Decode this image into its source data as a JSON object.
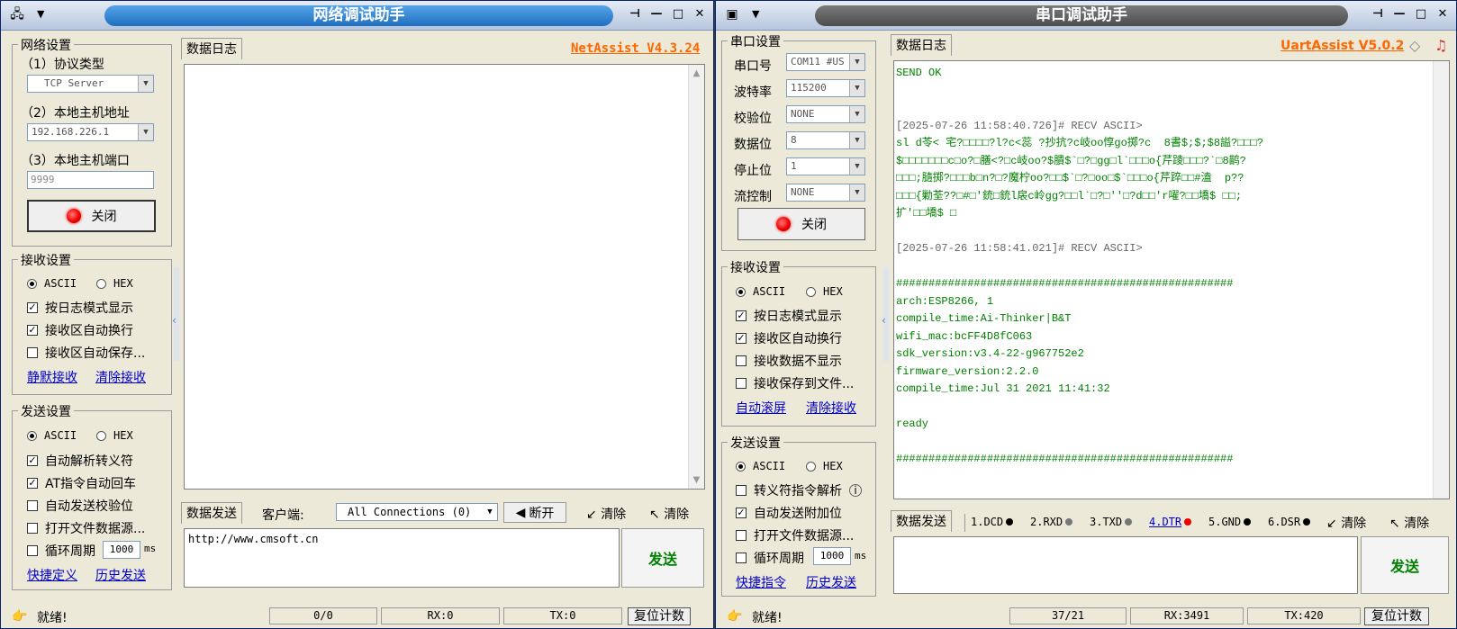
{
  "net": {
    "title": "网络调试助手",
    "brand": "NetAssist V4.3.24",
    "net_settings": {
      "group": "网络设置",
      "protocol_label": "（1）协议类型",
      "protocol_value": "TCP Server",
      "host_label": "（2）本地主机地址",
      "host_value": "192.168.226.1",
      "port_label": "（3）本地主机端口",
      "port_value": "9999",
      "close_button": "关闭"
    },
    "recv_settings": {
      "group": "接收设置",
      "ascii": "ASCII",
      "hex": "HEX",
      "opt1": "按日志模式显示",
      "opt2": "接收区自动换行",
      "opt3": "接收区自动保存...",
      "link1": "静默接收",
      "link2": "清除接收"
    },
    "send_settings": {
      "group": "发送设置",
      "ascii": "ASCII",
      "hex": "HEX",
      "opt1": "自动解析转义符",
      "opt2": "AT指令自动回车",
      "opt3": "自动发送校验位",
      "opt4": "打开文件数据源...",
      "opt5": "循环周期",
      "period": "1000",
      "unit": "ms",
      "link1": "快捷定义",
      "link2": "历史发送"
    },
    "log_tab": "数据日志",
    "send_tab": "数据发送",
    "client_label": "客户端:",
    "client_value": "All Connections (0)",
    "disconnect": "断开",
    "clear1": "清除",
    "clear2": "清除",
    "send_text": "http://www.cmsoft.cn",
    "send_button": "发送",
    "status": {
      "ready": "就绪!",
      "count": "0/0",
      "rx": "RX:0",
      "tx": "TX:0",
      "reset": "复位计数"
    }
  },
  "uart": {
    "title": "串口调试助手",
    "brand": "UartAssist V5.0.2",
    "port_settings": {
      "group": "串口设置",
      "port_label": "串口号",
      "port_value": "COM11 #US",
      "baud_label": "波特率",
      "baud_value": "115200",
      "parity_label": "校验位",
      "parity_value": "NONE",
      "data_label": "数据位",
      "data_value": "8",
      "stop_label": "停止位",
      "stop_value": "1",
      "flow_label": "流控制",
      "flow_value": "NONE",
      "close_button": "关闭"
    },
    "recv_settings": {
      "group": "接收设置",
      "ascii": "ASCII",
      "hex": "HEX",
      "opt1": "按日志模式显示",
      "opt2": "接收区自动换行",
      "opt3": "接收数据不显示",
      "opt4": "接收保存到文件...",
      "link1": "自动滚屏",
      "link2": "清除接收"
    },
    "send_settings": {
      "group": "发送设置",
      "ascii": "ASCII",
      "hex": "HEX",
      "opt1": "转义符指令解析",
      "opt2": "自动发送附加位",
      "opt3": "打开文件数据源...",
      "opt4": "循环周期",
      "period": "1000",
      "unit": "ms",
      "link1": "快捷指令",
      "link2": "历史发送"
    },
    "log_tab": "数据日志",
    "log_lines": [
      "SEND OK",
      "",
      "",
      "[2025-07-26 11:58:40.726]# RECV ASCII>",
      "sl d苓< 宅?□□□□?l?c<蕊 ?抄抗?c岐oo惇go掷?c  8書$;$;$8謚?□□□?",
      "$□□□□□□□c□o?□膳<?□c岐oo?$膭$`□?□gg□l`□□□o{芹踜□□□?`□8鹋?",
      "□□□;膸掷?□□□b□n?□?魔柠oo?□□$`□?□oo□$`□□□o{芹踤□□#溘  p??",
      "□□□{勦荃??□#□′銃□銃l扆c岭gg?□□l`□?□′′□?d□□′r嚁?□□墧$ □□;",
      "扩′□□墧$ □",
      "",
      "[2025-07-26 11:58:41.021]# RECV ASCII>",
      "",
      "####################################################",
      "arch:ESP8266, 1",
      "compile_time:Ai-Thinker|B&T",
      "wifi_mac:bcFF4D8fC063",
      "sdk_version:v3.4-22-g967752e2",
      "firmware_version:2.2.0",
      "compile_time:Jul 31 2021 11:41:32",
      "",
      "ready",
      "",
      "####################################################"
    ],
    "send_tab": "数据发送",
    "pins": [
      "1.DCD",
      "2.RXD",
      "3.TXD",
      "4.DTR",
      "5.GND",
      "6.DSR"
    ],
    "clear1": "清除",
    "clear2": "清除",
    "send_button": "发送",
    "status": {
      "ready": "就绪!",
      "count": "37/21",
      "rx": "RX:3491",
      "tx": "TX:420",
      "reset": "复位计数"
    }
  }
}
